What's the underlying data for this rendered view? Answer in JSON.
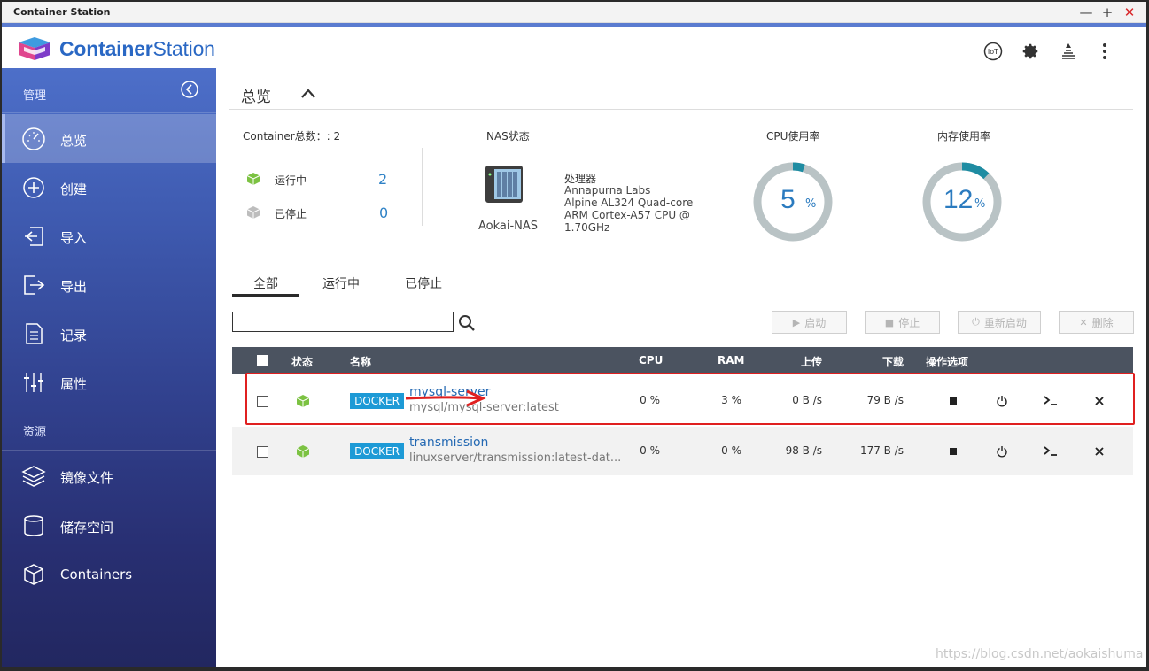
{
  "window": {
    "title": "Container Station",
    "min": "—",
    "max": "+",
    "close": "✕"
  },
  "header": {
    "brand_bold": "Container",
    "brand_light": "Station",
    "icons": [
      "iot-icon",
      "gear-icon",
      "stack-icon",
      "more-icon"
    ],
    "iot_label": "IoT"
  },
  "sidebar": {
    "group_manage": "管理",
    "group_resources": "资源",
    "items": [
      {
        "label": "总览",
        "icon": "dashboard-icon"
      },
      {
        "label": "创建",
        "icon": "plus-circle-icon"
      },
      {
        "label": "导入",
        "icon": "import-icon"
      },
      {
        "label": "导出",
        "icon": "export-icon"
      },
      {
        "label": "记录",
        "icon": "document-icon"
      },
      {
        "label": "属性",
        "icon": "sliders-icon"
      }
    ],
    "resources": [
      {
        "label": "镜像文件",
        "icon": "layers-icon"
      },
      {
        "label": "储存空间",
        "icon": "database-icon"
      },
      {
        "label": "Containers",
        "icon": "cube-icon"
      }
    ]
  },
  "main": {
    "breadcrumb": "总览",
    "summary": {
      "container_total_label": "Container总数：: 2",
      "running_label": "运行中",
      "running_count": "2",
      "stopped_label": "已停止",
      "stopped_count": "0"
    },
    "nas": {
      "title": "NAS状态",
      "name": "Aokai-NAS",
      "cpu_title": "处理器",
      "cpu_lines": [
        "Annapurna Labs",
        "Alpine AL324 Quad-core",
        "ARM Cortex-A57 CPU @",
        "1.70GHz"
      ]
    },
    "cpu_usage": {
      "title": "CPU使用率",
      "value": "5",
      "unit": "%",
      "fraction": 0.05
    },
    "mem_usage": {
      "title": "内存使用率",
      "value": "12",
      "unit": "%",
      "fraction": 0.12
    },
    "tabs": [
      "全部",
      "运行中",
      "已停止"
    ],
    "search": {
      "value": "",
      "placeholder": ""
    },
    "actions": [
      {
        "label": "启动",
        "icon": "▶"
      },
      {
        "label": "停止",
        "icon": "■"
      },
      {
        "label": "重新启动",
        "icon": "⏻"
      },
      {
        "label": "删除",
        "icon": "✕"
      }
    ],
    "table": {
      "headers": {
        "status": "状态",
        "name": "名称",
        "cpu": "CPU",
        "ram": "RAM",
        "upload": "上传",
        "download": "下载",
        "ops": "操作选项"
      },
      "rows": [
        {
          "type": "DOCKER",
          "name": "mysql-server",
          "image": "mysql/mysql-server:latest",
          "cpu": "0 %",
          "ram": "3 %",
          "upload": "0 B /s",
          "download": "79 B /s"
        },
        {
          "type": "DOCKER",
          "name": "transmission",
          "image": "linuxserver/transmission:latest-dat...",
          "cpu": "0 %",
          "ram": "0 %",
          "upload": "98 B /s",
          "download": "177 B /s"
        }
      ]
    }
  },
  "watermark": "https://blog.csdn.net/aokaishuma",
  "colors": {
    "accent": "#2a68c4",
    "sidebar_top": "#4d6fc9",
    "sidebar_bottom": "#222760",
    "docker_badge": "#1d9ad6",
    "running_green": "#7cc242",
    "annotation_red": "#e02020"
  }
}
